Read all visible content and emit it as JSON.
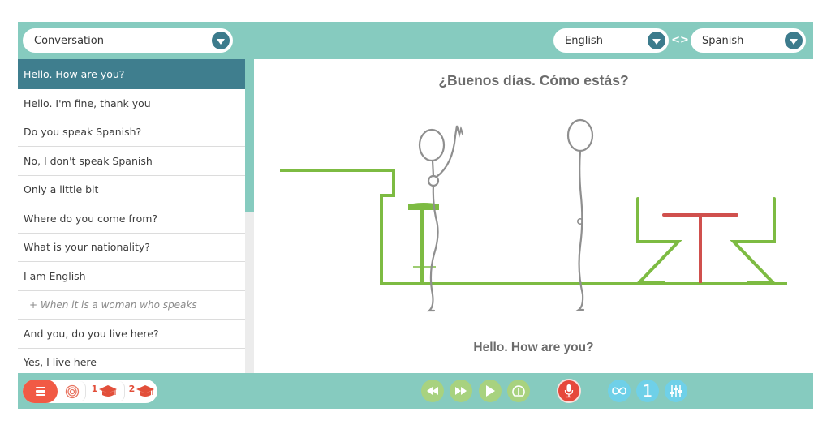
{
  "header": {
    "topic_select": {
      "value": "Conversation",
      "icon": "chevron-down-icon"
    },
    "source_language": {
      "value": "English",
      "icon": "chevron-down-icon"
    },
    "swap_icon": "swap-arrows-icon",
    "swap_glyph": "<>",
    "target_language": {
      "value": "Spanish",
      "icon": "chevron-down-icon"
    }
  },
  "phrase_list": {
    "active_index": 0,
    "items": [
      {
        "label": "Hello. How are you?",
        "type": "phrase"
      },
      {
        "label": "Hello. I'm fine, thank you",
        "type": "phrase"
      },
      {
        "label": "Do you speak Spanish?",
        "type": "phrase"
      },
      {
        "label": "No, I don't speak Spanish",
        "type": "phrase"
      },
      {
        "label": "Only a little bit",
        "type": "phrase"
      },
      {
        "label": "Where do you come from?",
        "type": "phrase"
      },
      {
        "label": "What is your nationality?",
        "type": "phrase"
      },
      {
        "label": "I am English",
        "type": "phrase"
      },
      {
        "label": "+ When it is a woman who speaks",
        "type": "note"
      },
      {
        "label": "And you, do you live here?",
        "type": "phrase"
      },
      {
        "label": "Yes, I live here",
        "type": "phrase"
      }
    ]
  },
  "stage": {
    "target_phrase": "¿Buenos días. Cómo estás?",
    "source_phrase": "Hello. How are you?",
    "scene": "two stick figures, bar counter with stool, table with two chairs",
    "colors": {
      "furniture": "#7dbb42",
      "table": "#d0504d",
      "figure": "#8f8f8f"
    }
  },
  "footer": {
    "left": {
      "menu_icon": "hamburger-menu-icon",
      "target_icon": "target-icon",
      "levels": [
        {
          "number": "1",
          "icon": "graduation-cap-icon"
        },
        {
          "number": "2",
          "icon": "graduation-cap-icon"
        }
      ]
    },
    "playback": [
      {
        "name": "rewind-button",
        "icon": "rewind-icon"
      },
      {
        "name": "fast-forward-button",
        "icon": "fast-forward-icon"
      },
      {
        "name": "play-button",
        "icon": "play-icon"
      },
      {
        "name": "speed-button",
        "icon": "speedometer-icon"
      }
    ],
    "record": {
      "icon": "microphone-icon"
    },
    "options": {
      "loop_icon": "infinity-icon",
      "repeat_count": "1",
      "settings_icon": "equalizer-icon"
    }
  },
  "colors": {
    "frame": "#86cbbf",
    "active_item": "#3f7e8e",
    "caret": "#3c7b8c",
    "accent_red": "#f15a45",
    "playback_green": "#a8d27f",
    "option_blue": "#6fd0e8"
  }
}
